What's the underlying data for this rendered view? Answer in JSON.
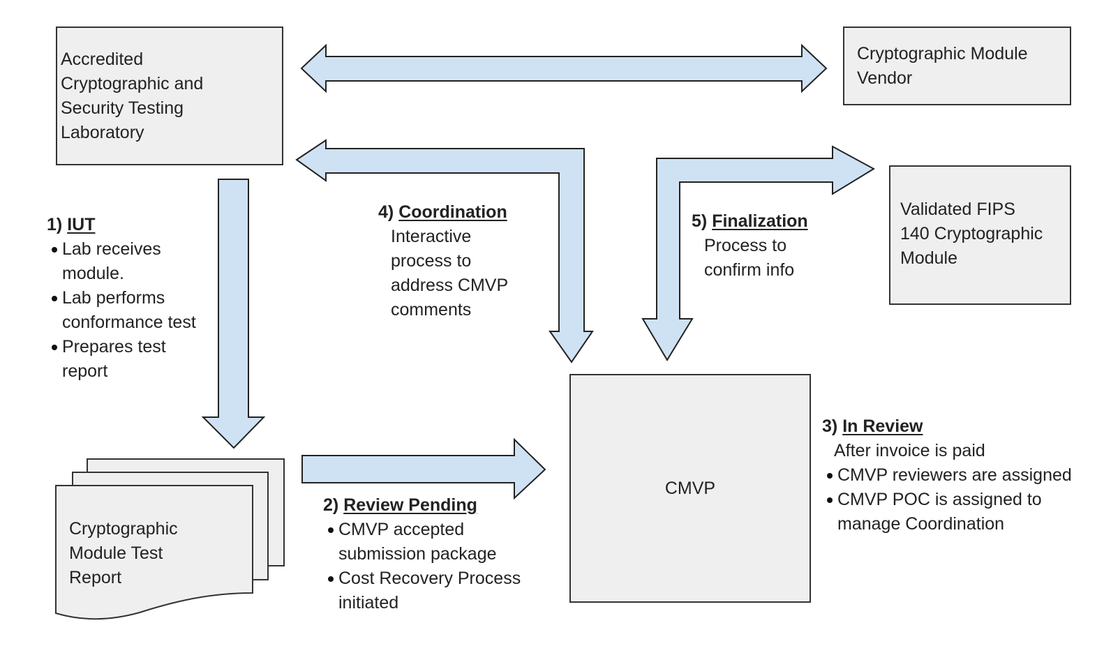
{
  "colors": {
    "box_fill": "#efefef",
    "box_stroke": "#333333",
    "arrow_fill": "#cfe2f3",
    "arrow_stroke": "#222222",
    "text": "#222222"
  },
  "nodes": {
    "lab": {
      "lines": [
        "Accredited",
        "Cryptographic and",
        "Security Testing",
        "Laboratory"
      ]
    },
    "vendor": {
      "lines": [
        "Cryptographic Module",
        "Vendor"
      ]
    },
    "validated": {
      "lines": [
        "Validated FIPS",
        "140 Cryptographic",
        "Module"
      ]
    },
    "cmvp": {
      "label": "CMVP"
    },
    "report": {
      "lines": [
        "Cryptographic",
        "Module Test",
        "Report"
      ]
    }
  },
  "steps": {
    "iut": {
      "number": "1)",
      "title": "IUT",
      "bullets": [
        "Lab receives module.",
        "Lab performs conformance test",
        "Prepares test report"
      ]
    },
    "review_pending": {
      "number": "2)",
      "title": "Review Pending",
      "bullets": [
        "CMVP accepted submission package",
        "Cost Recovery Process initiated"
      ]
    },
    "in_review": {
      "number": "3)",
      "title": "In Review",
      "description": "After invoice is paid",
      "bullets": [
        "CMVP reviewers are assigned",
        "CMVP POC is assigned to manage Coordination"
      ]
    },
    "coordination": {
      "number": "4)",
      "title": "Coordination",
      "description_lines": [
        "Interactive",
        "process to",
        "address CMVP",
        "comments"
      ]
    },
    "finalization": {
      "number": "5)",
      "title": "Finalization",
      "description_lines": [
        "Process to",
        "confirm info"
      ]
    }
  },
  "edges": [
    {
      "from": "lab",
      "to": "vendor",
      "type": "bidirectional"
    },
    {
      "from": "lab",
      "to": "report",
      "type": "directed",
      "step": "iut"
    },
    {
      "from": "report",
      "to": "cmvp",
      "type": "directed",
      "step": "review_pending"
    },
    {
      "from": "cmvp",
      "to": "lab",
      "type": "bidirectional-elbow",
      "step": "coordination"
    },
    {
      "from": "cmvp",
      "to": "validated",
      "type": "bidirectional-elbow",
      "step": "finalization"
    }
  ]
}
